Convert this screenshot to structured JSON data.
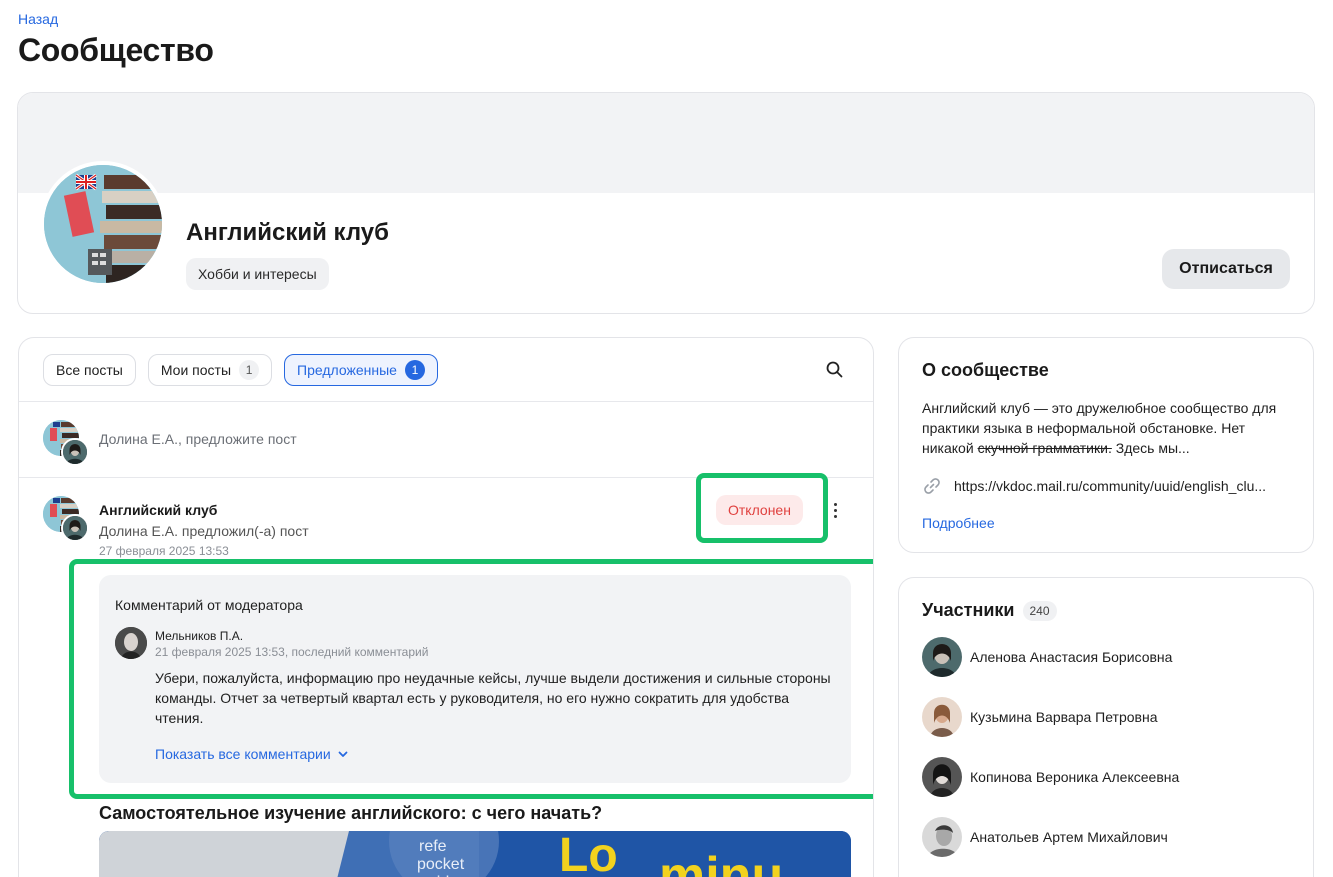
{
  "nav": {
    "back_label": "Назад",
    "page_title": "Сообщество"
  },
  "community": {
    "name": "Английский клуб",
    "category": "Хобби и интересы",
    "unsubscribe_label": "Отписаться"
  },
  "feed": {
    "tabs": [
      {
        "label": "Все посты",
        "count": ""
      },
      {
        "label": "Мои посты",
        "count": "1"
      },
      {
        "label": "Предложенные",
        "count": "1"
      }
    ],
    "suggest_prompt": "Долина Е.А., предложите пост",
    "post": {
      "author": "Английский клуб",
      "subtitle": "Долина Е.А. предложил(-а) пост",
      "date": "27 февраля 2025 13:53",
      "status": "Отклонен",
      "comment": {
        "heading": "Комментарий от модератора",
        "author": "Мельников П.А.",
        "date": "21 февраля 2025 13:53, последний комментарий",
        "text": "Убери, пожалуйста, информацию про неудачные кейсы, лучше выдели достижения и сильные стороны команды. Отчет за четвертый квартал есть у руководителя, но его нужно сократить для удобства чтения.",
        "show_all_label": "Показать все комментарии"
      },
      "title": "Самостоятельное изучение английского: с чего начать?"
    }
  },
  "about": {
    "title": "О сообществе",
    "text_before": "Английский клуб — это дружелюбное сообщество для практики языка в неформальной обстановке. Нет никакой ",
    "text_struck": "скучной грамматики.",
    "text_after": " Здесь мы...",
    "link": "https://vkdoc.mail.ru/community/uuid/english_clu...",
    "more_label": "Подробнее"
  },
  "members": {
    "title": "Участники",
    "count": "240",
    "list": [
      "Аленова Анастасия Борисовна",
      "Кузьмина Варвара Петровна",
      "Копинова Вероника Алексеевна",
      "Анатольев Артем Михайлович"
    ]
  },
  "colors": {
    "accent": "#2668e0",
    "highlight": "#17c06a",
    "danger": "#e0413f"
  }
}
